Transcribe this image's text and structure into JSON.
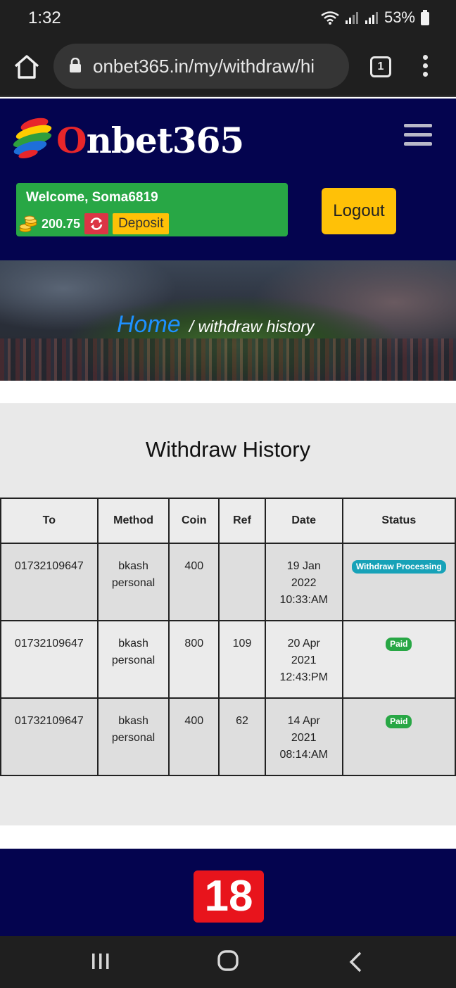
{
  "status": {
    "time": "1:32",
    "battery": "53%"
  },
  "browser": {
    "url": "onbet365.in/my/withdraw/hi",
    "tab_count": "1"
  },
  "site": {
    "logo_initial": "O",
    "logo_rest": "nbet365",
    "welcome": "Welcome, Soma6819",
    "balance": "200.75",
    "deposit_label": "Deposit",
    "logout_label": "Logout"
  },
  "breadcrumb": {
    "home": "Home",
    "current": "/ withdraw history"
  },
  "page": {
    "title": "Withdraw History"
  },
  "table": {
    "headers": [
      "To",
      "Method",
      "Coin",
      "Ref",
      "Date",
      "Status"
    ],
    "rows": [
      {
        "to": "01732109647",
        "method_1": "bkash",
        "method_2": "personal",
        "coin": "400",
        "ref": "",
        "date_1": "19 Jan",
        "date_2": "2022",
        "date_3": "10:33:AM",
        "status": "Withdraw Processing"
      },
      {
        "to": "01732109647",
        "method_1": "bkash",
        "method_2": "personal",
        "coin": "800",
        "ref": "109",
        "date_1": "20 Apr",
        "date_2": "2021",
        "date_3": "12:43:PM",
        "status": "Paid"
      },
      {
        "to": "01732109647",
        "method_1": "bkash",
        "method_2": "personal",
        "coin": "400",
        "ref": "62",
        "date_1": "14 Apr",
        "date_2": "2021",
        "date_3": "08:14:AM",
        "status": "Paid"
      }
    ]
  },
  "footer": {
    "age_label": "18"
  },
  "colors": {
    "header_bg": "#04044f",
    "welcome_bg": "#28a745",
    "button_yellow": "#ffc107",
    "refresh_red": "#dc3545",
    "badge_info": "#17a2b8",
    "badge_success": "#28a745"
  }
}
